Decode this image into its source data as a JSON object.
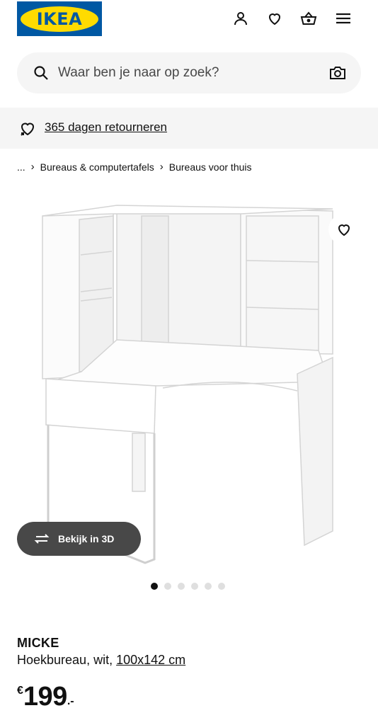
{
  "header": {
    "logo_text": "IKEA",
    "icons": [
      "user-icon",
      "heart-icon",
      "basket-icon",
      "menu-icon"
    ]
  },
  "search": {
    "placeholder": "Waar ben je naar op zoek?"
  },
  "banner": {
    "text": "365 dagen retourneren"
  },
  "breadcrumb": {
    "ellipsis": "...",
    "items": [
      "Bureaus & computertafels",
      "Bureaus voor thuis"
    ]
  },
  "gallery": {
    "view_3d_label": "Bekijk in 3D",
    "dot_count": 6,
    "active_index": 0
  },
  "product": {
    "name": "MICKE",
    "description": "Hoekbureau, wit,",
    "dimensions": "100x142 cm",
    "price_currency": "€",
    "price_amount": "199",
    "price_decimal": ".-"
  },
  "colors": {
    "brand_blue": "#0058a3",
    "brand_yellow": "#ffdb00",
    "search_bg": "#f5f5f5",
    "button_dark": "#484848"
  }
}
